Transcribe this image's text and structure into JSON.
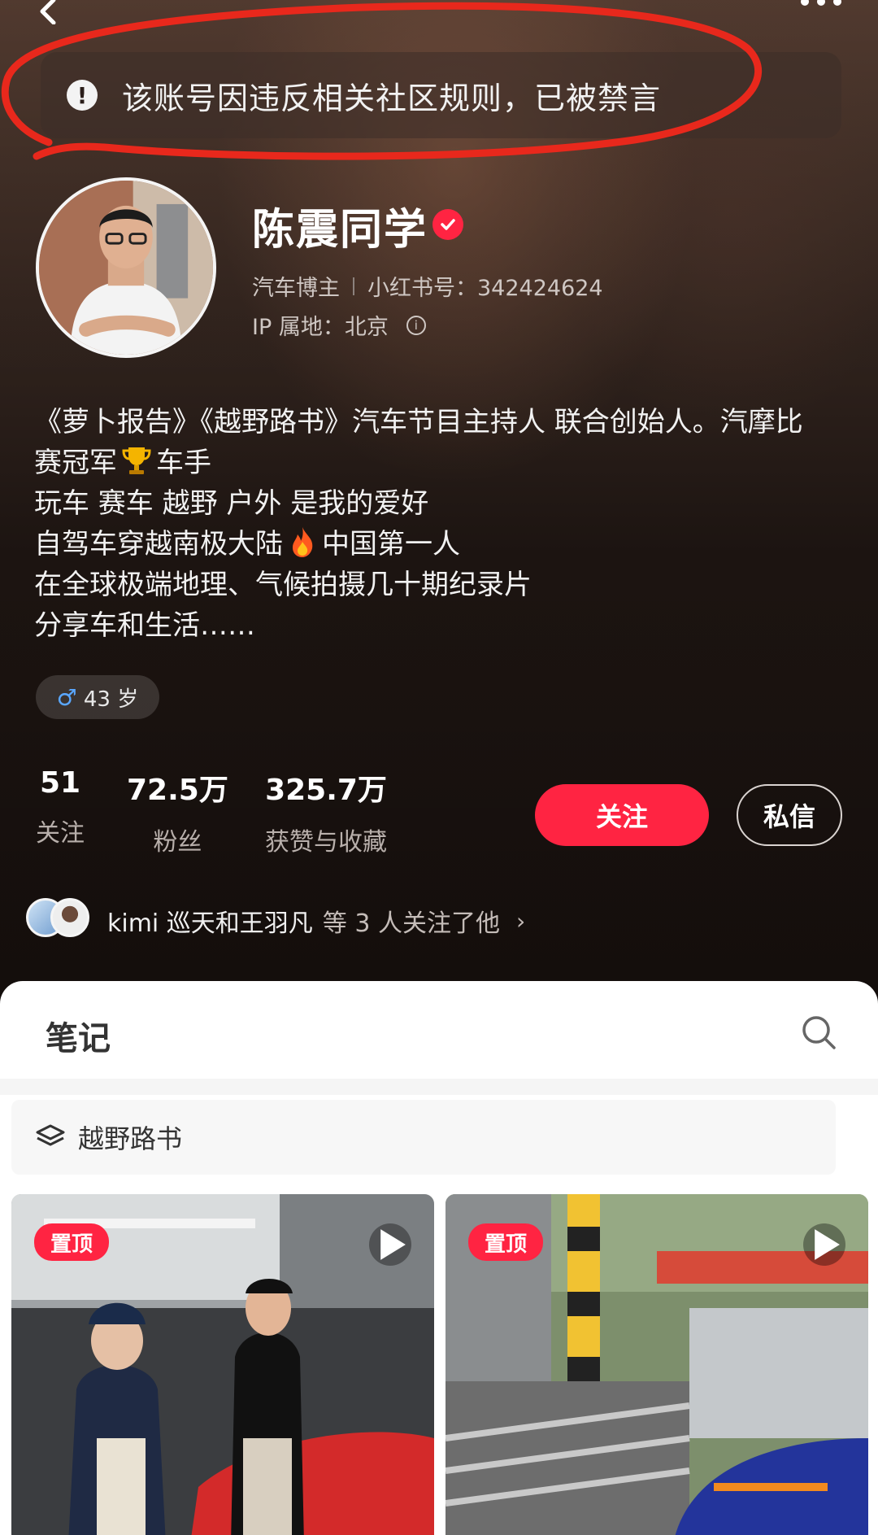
{
  "notice": {
    "text": "该账号因违反相关社区规则，已被禁言"
  },
  "profile": {
    "nickname": "陈震同学",
    "category": "汽车博主",
    "account_id": "小红书号：342424624",
    "ip_location": "IP 属地：北京"
  },
  "bio": {
    "line1": "《萝卜报告》《越野路书》汽车节目主持人 联合创始人。汽摩比",
    "line2_prefix": "赛冠军",
    "line2_suffix": "车手",
    "line3": "玩车 赛车 越野 户外 是我的爱好",
    "line4_prefix": "自驾车穿越南极大陆",
    "line4_suffix": "中国第一人",
    "line5": "在全球极端地理、气候拍摄几十期纪录片",
    "line6": "分享车和生活……"
  },
  "age_tag": "43 岁",
  "stats": {
    "following": {
      "value": "51",
      "label": "关注"
    },
    "followers": {
      "value": "72.5万",
      "label": "粉丝"
    },
    "likes": {
      "value": "325.7万",
      "label": "获赞与收藏"
    }
  },
  "actions": {
    "follow": "关注",
    "message": "私信"
  },
  "mutual": {
    "names": "kimi 巡天和王羽凡",
    "suffix": "等 3 人关注了他",
    "chevron": "›"
  },
  "notes": {
    "tab": "笔记",
    "collection": "越野路书",
    "cards": [
      {
        "badge": "置顶"
      },
      {
        "badge": "置顶"
      }
    ]
  },
  "icons": [
    "back-icon",
    "more-icon",
    "warning-icon",
    "verified-icon",
    "info-icon",
    "male-icon",
    "trophy-icon",
    "fire-icon",
    "search-icon",
    "layers-icon",
    "play-icon"
  ],
  "colors": {
    "brand_red": "#ff2442",
    "annotation_red": "#e8281c"
  }
}
